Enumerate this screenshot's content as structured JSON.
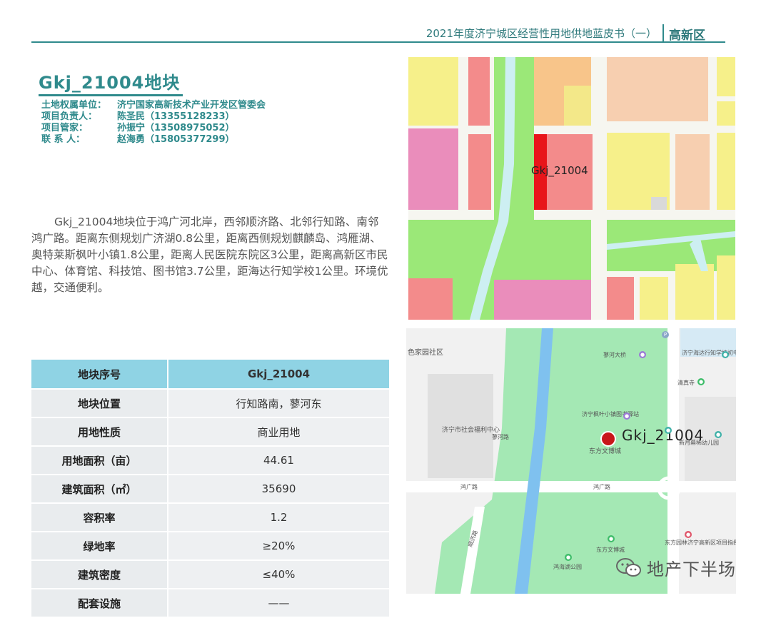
{
  "header": {
    "title": "2021年度济宁城区经营性用地供地蓝皮书（一）",
    "district": "高新区"
  },
  "plot": {
    "title": "Gkj_21004地块"
  },
  "info": [
    {
      "label": "土地权属单位：",
      "value": "济宁国家高新技术产业开发区管委会"
    },
    {
      "label": "项目负责人：",
      "value": "陈圣民（13355128233）"
    },
    {
      "label": "项目管家：",
      "value": "孙振宁（13508975052）"
    },
    {
      "label": "联 系 人：",
      "value": "赵海勇（15805377299）"
    }
  ],
  "description": "Gkj_21004地块位于鸿广河北岸，西邻顺济路、北邻行知路、南邻鸿广路。距离东侧规划广济湖0.8公里，距离西侧规划麒麟岛、鸿雁湖、奥特莱斯枫叶小镇1.8公里，距离人民医院东院区3公里，距离高新区市民中心、体育馆、科技馆、图书馆3.7公里，距海达行知学校1公里。环境优越，交通便利。",
  "table": {
    "header": {
      "key": "地块序号",
      "value": "Gkj_21004"
    },
    "rows": [
      {
        "key": "地块位置",
        "value": "行知路南，蓼河东"
      },
      {
        "key": "用地性质",
        "value": "商业用地"
      },
      {
        "key": "用地面积（亩）",
        "value": "44.61"
      },
      {
        "key": "建筑面积（㎡）",
        "value": "35690"
      },
      {
        "key": "容积率",
        "value": "1.2"
      },
      {
        "key": "绿地率",
        "value": "≥20%"
      },
      {
        "key": "建筑密度",
        "value": "≤40%"
      },
      {
        "key": "配套设施",
        "value": "——"
      }
    ]
  },
  "planning_map": {
    "plot_label": "Gkj_21004",
    "colors": {
      "commercial": "#f38b8b",
      "residential": "#f6f08a",
      "green": "#9be878",
      "water": "#cdeff2",
      "plot": "#e8161a",
      "pink": "#ea8dbb",
      "orange": "#f8c58a",
      "peach": "#f7cfb0"
    }
  },
  "location_map": {
    "plot_label": "Gkj_21004",
    "pois": {
      "community": "色家园社区",
      "welfare": "济宁市社会福利中心",
      "liao_river": "蓼河路",
      "honggang_road_w": "鸿广路",
      "honggang_road_e": "鸿广路",
      "expo": "东方文博城",
      "maple": "济宁枫叶小镇图书驿站",
      "liao_bridge": "蓼河大桥",
      "school": "济宁海达行知学校初中楼",
      "qingzhen": "清真寺",
      "kinder": "新月幕稀幼儿园",
      "expo2": "东方文博城",
      "garden": "东方园林济宁高新区项目指挥部",
      "honghai": "鸿海湖公园",
      "shunji": "顺济路"
    }
  },
  "watermark": {
    "text": "地产下半场",
    "icon": "wechat-icon"
  }
}
